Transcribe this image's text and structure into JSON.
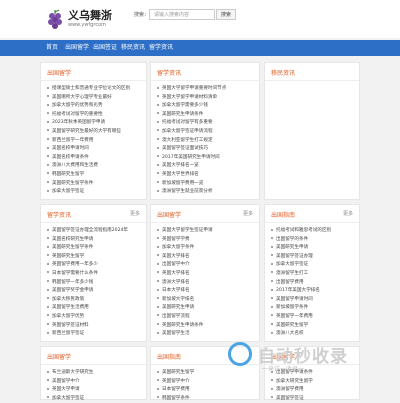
{
  "header": {
    "logo_icon": "grape-icon",
    "title": "义乌舞浙",
    "url": "www.ywfgrcom",
    "search_label": "搜索：",
    "search_placeholder": "请输入搜索内容",
    "search_button": "搜索"
  },
  "nav": {
    "items": [
      "首页",
      "出国留学",
      "出国签证",
      "移民资讯",
      "留学资讯"
    ]
  },
  "panels": [
    {
      "title": "出国留学",
      "more": "",
      "items": [
        "授课型硕士和普通专业学位论文的区别",
        "美国哪所大学心理学专业最好",
        "加拿大留学的优势和劣势",
        "托福考试对留学的重要性",
        "2023年秋季英国留学申请",
        "美国留学研究生最好的大学有哪些",
        "新西兰留学一年费用",
        "美国名校申请时间",
        "美国名校申请条件",
        "澳洲八大费用和生活费",
        "韩国研究生留学",
        "美国研究生留学条件",
        "加拿大留学签证",
        "出国留学需要哪些资料"
      ]
    },
    {
      "title": "留学资讯",
      "more": "",
      "items": [
        "英国大学留学申请重要时间节点",
        "英国大学留学申请材料清单",
        "加拿大留学需要多少钱",
        "美国研究生申请条件",
        "托福考试对留学有多重要",
        "加拿大留学签证申请流程",
        "澳大利亚留学生打工规定",
        "美国留学签证面试技巧",
        "2017年美国研究生申请时间",
        "美国大学排名一览",
        "英国大学世界排名",
        "新加坡留学费用一览",
        "澳洲留学生就业前景分析"
      ]
    },
    {
      "title": "移民资讯",
      "more": "",
      "items": []
    },
    {
      "title": "留学资讯",
      "more": "更多",
      "items": [
        "美国留学签证办理全流程指南2024年",
        "美国名校研究生申请",
        "美国研究生留学条件",
        "英国研究生留学",
        "英国留学费用一年多少",
        "日本留学需要什么条件",
        "韩国留学一年多少钱",
        "美国留学奖学金申请",
        "加拿大移民政策",
        "美国留学生活费用",
        "加拿大留学优势",
        "英国留学签证材料",
        "新西兰留学签证",
        "澳洲留学生活",
        "美国留学签证面试"
      ]
    },
    {
      "title": "出国留学",
      "more": "更多",
      "items": [
        "美国大学留学生签证申请",
        "英国留学学费",
        "加拿大留学条件",
        "美国大学排名",
        "出国留学中介",
        "英国大学排名",
        "澳洲大学排名",
        "日本大学排名",
        "新加坡大学排名",
        "美国研究生申请",
        "出国留学流程",
        "英国研究生申请条件",
        "美国留学生活",
        "德国留学要求",
        "加拿大留学签证"
      ]
    },
    {
      "title": "出国指南",
      "more": "更多",
      "items": [
        "托福考试和雅思考试的区别",
        "出国留学的条件",
        "美国研究生申请",
        "美国留学签证办理",
        "加拿大留学签证",
        "澳洲留学生打工",
        "出国留学费用",
        "2017年美国大学排名",
        "美国留学申请时间",
        "新加坡留学条件",
        "英国留学一年费用",
        "美国研究生留学",
        "澳洲八大名校",
        "英国留学签证",
        "2023年英国留学趋势"
      ]
    },
    {
      "title": "出国留学",
      "more": "",
      "items": [
        "布兰迪斯大学研究生",
        "美国留学中介",
        "英国大学申请",
        "加拿大留学签证",
        "澳洲留学中介"
      ]
    },
    {
      "title": "出国指南",
      "more": "",
      "items": [
        "美国研究生留学",
        "英国留学中介",
        "日本留学费用",
        "韩国留学条件",
        "出国留学签证"
      ]
    },
    {
      "title": "出国留学",
      "more": "",
      "items": [
        "出国留学申请条件",
        "加拿大研究生留学",
        "澳洲留学费用",
        "美国留学签证",
        "英国留学条件"
      ]
    }
  ],
  "watermark": {
    "text": "自动秒收录",
    "sub": "一来访一收录一"
  }
}
